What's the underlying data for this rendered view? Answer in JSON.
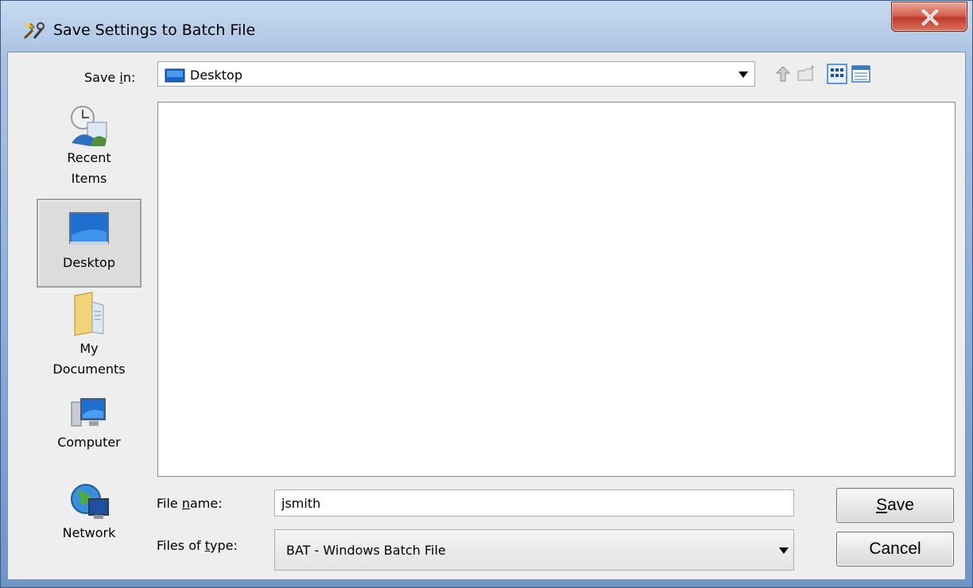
{
  "window": {
    "title": "Save Settings to Batch File",
    "close_label": "X"
  },
  "toolbar": {
    "save_in_label_pre": "Save ",
    "save_in_label_mnemonic": "i",
    "save_in_label_post": "n:",
    "save_in_value": "Desktop",
    "icons": [
      "up-one-level-icon",
      "create-new-folder-icon",
      "list-view-icon",
      "details-view-icon"
    ]
  },
  "places": [
    {
      "label_line1": "Recent",
      "label_line2": "Items",
      "icon": "recent-items-icon"
    },
    {
      "label_line1": "Desktop",
      "label_line2": "",
      "icon": "desktop-icon",
      "selected": true
    },
    {
      "label_line1": "My",
      "label_line2": "Documents",
      "icon": "my-documents-icon"
    },
    {
      "label_line1": "Computer",
      "label_line2": "",
      "icon": "computer-icon"
    },
    {
      "label_line1": "Network",
      "label_line2": "",
      "icon": "network-icon"
    }
  ],
  "form": {
    "file_name_label_pre": "File ",
    "file_name_label_mnemonic": "n",
    "file_name_label_post": "ame:",
    "file_name_value": "jsmith",
    "file_type_label_pre": "Files of ",
    "file_type_label_mnemonic": "t",
    "file_type_label_post": "ype:",
    "file_type_value": "BAT - Windows Batch File"
  },
  "buttons": {
    "save_mnemonic": "S",
    "save_rest": "ave",
    "cancel": "Cancel"
  },
  "colors": {
    "title_gradient_top": "#c8daf0",
    "title_gradient_bottom": "#6e95c6",
    "close_button": "#c0392b",
    "selection_bg": "#dcdcdc"
  }
}
